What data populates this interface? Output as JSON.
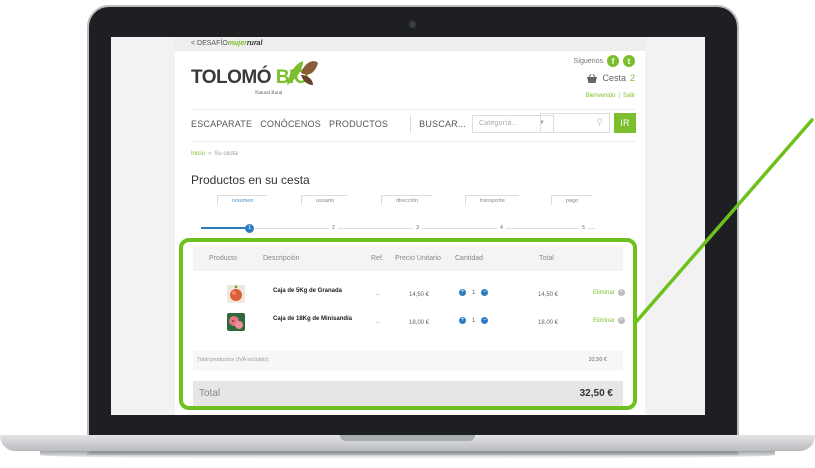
{
  "site": {
    "top_link": "< DESAFÍO",
    "top_brand_green": "mujer",
    "top_brand_italic": "rural",
    "logo_main": "TOLOMÓ",
    "logo_bio": "BIO",
    "logo_sub": "Natural Rural",
    "follow_label": "Síguenos",
    "cart_label": "Cesta",
    "cart_count": "2",
    "welcome": "Bienvenido",
    "logout": "Salir"
  },
  "nav": {
    "items": [
      "ESCAPARATE",
      "CONÓCENOS",
      "PRODUCTOS"
    ],
    "search_label": "BUSCAR...",
    "category_placeholder": "Categoría...",
    "go_label": "IR"
  },
  "breadcrumb": {
    "home": "Inicio",
    "current": "Su cesta"
  },
  "page_title": "Productos en su cesta",
  "steps": [
    {
      "label": "resumen",
      "num": "1"
    },
    {
      "label": "usuario",
      "num": "2"
    },
    {
      "label": "dirección",
      "num": "3"
    },
    {
      "label": "transporte",
      "num": "4"
    },
    {
      "label": "pago",
      "num": "5"
    }
  ],
  "table": {
    "headers": [
      "Producto",
      "Descripción",
      "Ref.",
      "Precio Unitario",
      "Cantidad",
      "Total"
    ],
    "rows": [
      {
        "description": "Caja de 5Kg de Granada",
        "ref": "--",
        "unit_price": "14,50 €",
        "qty": "1",
        "total": "14,50 €",
        "delete": "Eliminar"
      },
      {
        "description": "Caja de 18Kg de Minisandía",
        "ref": "--",
        "unit_price": "18,00 €",
        "qty": "1",
        "total": "18,00 €",
        "delete": "Eliminar"
      }
    ],
    "subtotal_label": "Total productos (IVA incluido):",
    "subtotal_value": "32,50 €",
    "total_label": "Total",
    "total_value": "32,50 €"
  },
  "colors": {
    "accent_green": "#7bbf2e",
    "highlight_green": "#6ec01c",
    "step_blue": "#2e7cc0"
  }
}
